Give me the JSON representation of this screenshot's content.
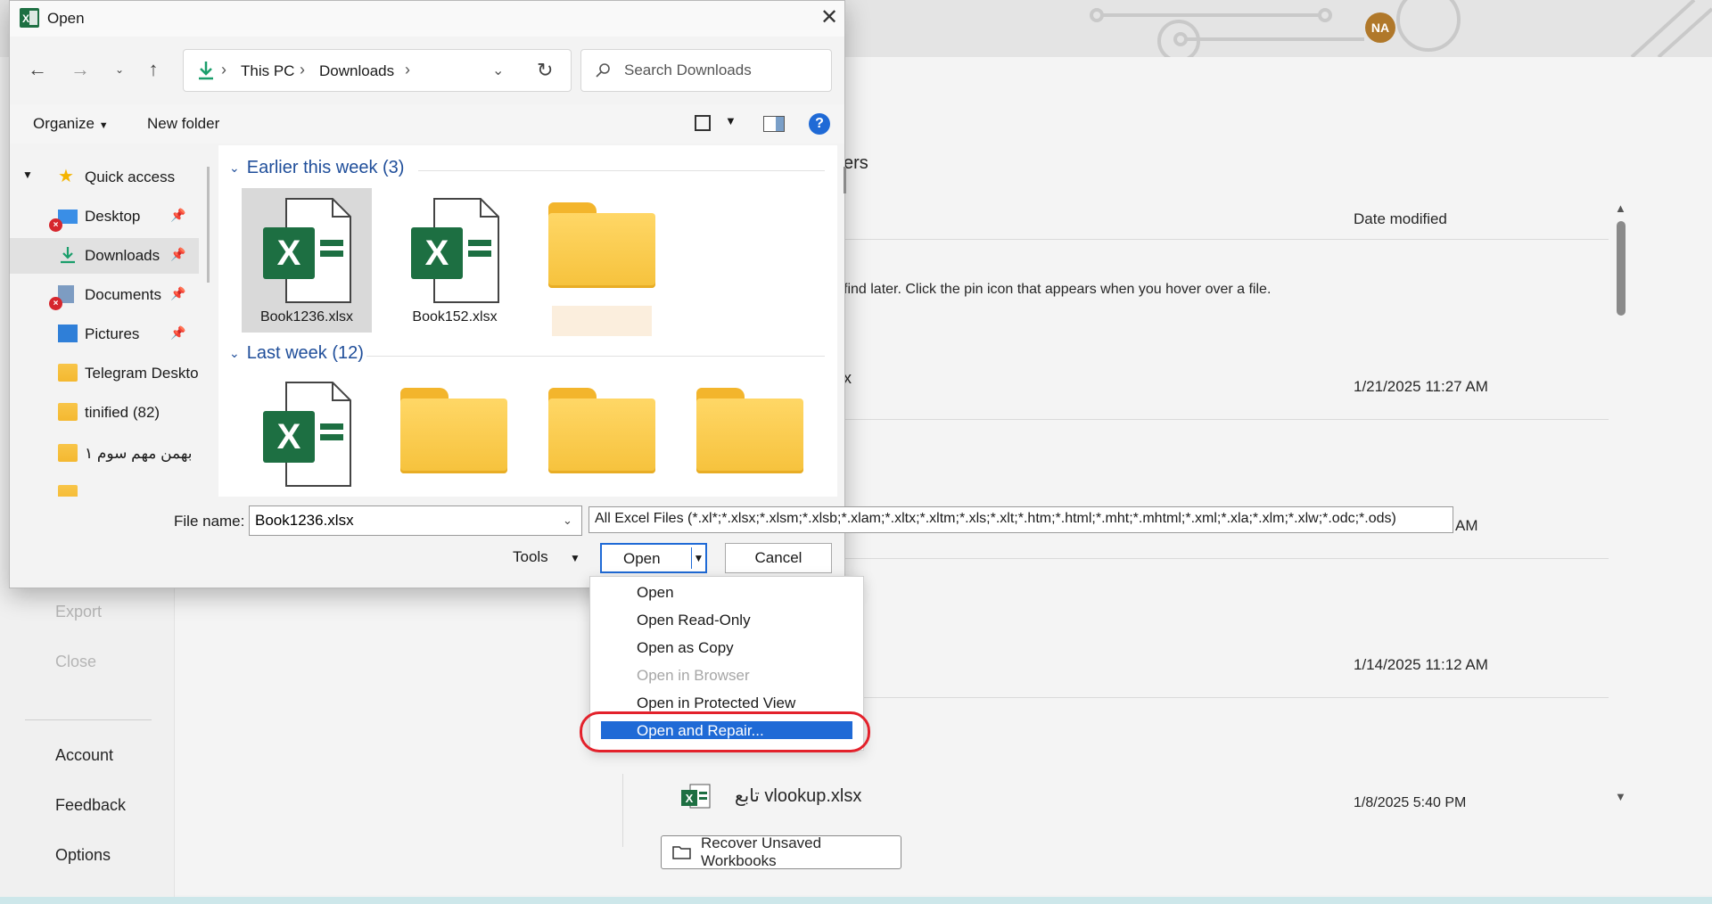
{
  "dialog": {
    "title": "Open",
    "close_glyph": "✕",
    "address": {
      "crumbs": [
        "This PC",
        "Downloads"
      ]
    },
    "search": {
      "placeholder": "Search Downloads"
    },
    "toolbar": {
      "organize": "Organize",
      "new_folder": "New folder",
      "help": "?"
    },
    "sidebar": {
      "items": [
        {
          "label": "Quick access",
          "icon": "star-icon"
        },
        {
          "label": "Desktop",
          "icon": "desktop-icon",
          "pinned": true,
          "error": true
        },
        {
          "label": "Downloads",
          "icon": "download-icon",
          "pinned": true,
          "selected": true
        },
        {
          "label": "Documents",
          "icon": "documents-icon",
          "pinned": true,
          "error": true
        },
        {
          "label": "Pictures",
          "icon": "pictures-icon",
          "pinned": true
        },
        {
          "label": "Telegram Deskto",
          "icon": "folder-icon"
        },
        {
          "label": "tinified (82)",
          "icon": "folder-icon"
        },
        {
          "label": "بهمن مهم سوم ۱",
          "icon": "folder-icon"
        }
      ]
    },
    "groups": [
      {
        "title": "Earlier this week (3)",
        "items": [
          {
            "label": "Book1236.xlsx",
            "type": "excel",
            "selected": true
          },
          {
            "label": "Book152.xlsx",
            "type": "excel"
          },
          {
            "label": "",
            "type": "folder"
          }
        ]
      },
      {
        "title": "Last week (12)",
        "items": [
          {
            "label": "",
            "type": "excel"
          },
          {
            "label": "",
            "type": "folder"
          },
          {
            "label": "",
            "type": "folder"
          },
          {
            "label": "",
            "type": "folder"
          }
        ]
      }
    ],
    "file_name_label": "File name:",
    "file_name_value": "Book1236.xlsx",
    "file_type": "All Excel Files (*.xl*;*.xlsx;*.xlsm;*.xlsb;*.xlam;*.xltx;*.xltm;*.xls;*.xlt;*.htm;*.html;*.mht;*.mhtml;*.xml;*.xla;*.xlm;*.xlw;*.odc;*.ods)",
    "tools_label": "Tools",
    "open_label": "Open",
    "cancel_label": "Cancel"
  },
  "open_menu": {
    "items": [
      {
        "label": "Open",
        "enabled": true
      },
      {
        "label": "Open Read-Only",
        "enabled": true
      },
      {
        "label": "Open as Copy",
        "enabled": true
      },
      {
        "label": "Open in Browser",
        "enabled": false
      },
      {
        "label": "Open in Protected View",
        "enabled": true
      },
      {
        "label": "Open and Repair...",
        "enabled": true,
        "highlighted": true
      }
    ]
  },
  "background": {
    "avatar": "NA",
    "left_nav": [
      "Export",
      "Close",
      "Account",
      "Feedback",
      "Options"
    ],
    "heading_fragment": "ers",
    "column_header": "Date modified",
    "pin_hint": "find later. Click the pin icon that appears when you hover over a file.",
    "rows": [
      {
        "name_fragment": "x",
        "date": "1/21/2025 11:27 AM"
      },
      {
        "name_fragment": "",
        "date": "AM"
      },
      {
        "name_fragment": "",
        "date": "1/14/2025 11:12 AM"
      },
      {
        "name_fragment": "تابع vlookup.xlsx",
        "date": "1/8/2025 5:40 PM"
      }
    ],
    "recover_button": "Recover Unsaved Workbooks"
  },
  "colors": {
    "accent": "#1f6ad6",
    "excel_green": "#1d6f42",
    "folder": "#f6c23c",
    "highlight_ring": "#e3212b"
  }
}
